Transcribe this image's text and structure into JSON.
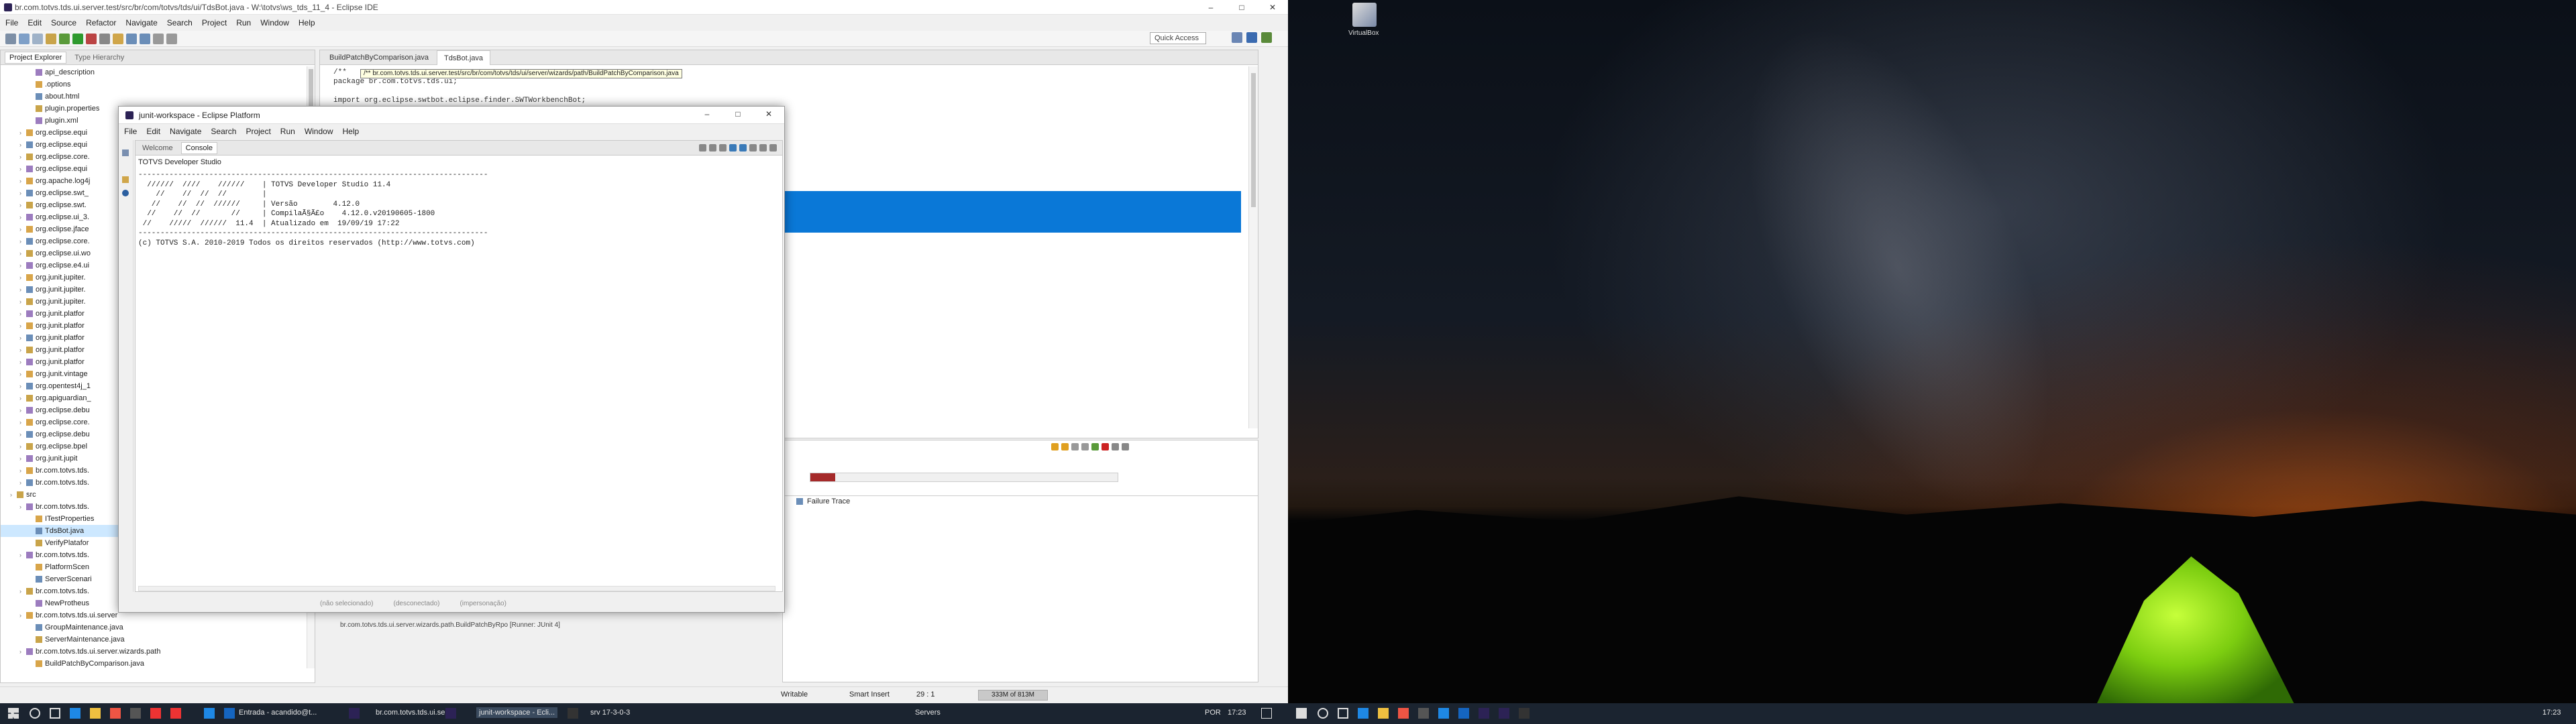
{
  "eclipse": {
    "title": "br.com.totvs.tds.ui.server.test/src/br/com/totvs/tds/ui/TdsBot.java - W:\\totvs\\ws_tds_11_4 - Eclipse IDE",
    "menu": [
      "File",
      "Edit",
      "Source",
      "Refactor",
      "Navigate",
      "Search",
      "Project",
      "Run",
      "Window",
      "Help"
    ],
    "quick_access": "Quick Access"
  },
  "project_explorer": {
    "tabs": [
      "Project Explorer",
      "Type Hierarchy"
    ],
    "items": [
      {
        "label": "api_description",
        "indent": 3
      },
      {
        "label": ".options",
        "indent": 3
      },
      {
        "label": "about.html",
        "indent": 3
      },
      {
        "label": "plugin.properties",
        "indent": 3
      },
      {
        "label": "plugin.xml",
        "indent": 3
      },
      {
        "label": "org.eclipse.equi",
        "indent": 2
      },
      {
        "label": "org.eclipse.equi",
        "indent": 2
      },
      {
        "label": "org.eclipse.core.",
        "indent": 2
      },
      {
        "label": "org.eclipse.equi",
        "indent": 2
      },
      {
        "label": "org.apache.log4j",
        "indent": 2
      },
      {
        "label": "org.eclipse.swt_",
        "indent": 2
      },
      {
        "label": "org.eclipse.swt.",
        "indent": 2
      },
      {
        "label": "org.eclipse.ui_3.",
        "indent": 2
      },
      {
        "label": "org.eclipse.jface",
        "indent": 2
      },
      {
        "label": "org.eclipse.core.",
        "indent": 2
      },
      {
        "label": "org.eclipse.ui.wo",
        "indent": 2
      },
      {
        "label": "org.eclipse.e4.ui",
        "indent": 2
      },
      {
        "label": "org.junit.jupiter.",
        "indent": 2
      },
      {
        "label": "org.junit.jupiter.",
        "indent": 2
      },
      {
        "label": "org.junit.jupiter.",
        "indent": 2
      },
      {
        "label": "org.junit.platfor",
        "indent": 2
      },
      {
        "label": "org.junit.platfor",
        "indent": 2
      },
      {
        "label": "org.junit.platfor",
        "indent": 2
      },
      {
        "label": "org.junit.platfor",
        "indent": 2
      },
      {
        "label": "org.junit.platfor",
        "indent": 2
      },
      {
        "label": "org.junit.vintage",
        "indent": 2
      },
      {
        "label": "org.opentest4j_1",
        "indent": 2
      },
      {
        "label": "org.apiguardian_",
        "indent": 2
      },
      {
        "label": "org.eclipse.debu",
        "indent": 2
      },
      {
        "label": "org.eclipse.core.",
        "indent": 2
      },
      {
        "label": "org.eclipse.debu",
        "indent": 2
      },
      {
        "label": "org.eclipse.bpel",
        "indent": 2
      },
      {
        "label": "org.junit.jupit",
        "indent": 2
      },
      {
        "label": "br.com.totvs.tds.",
        "indent": 2
      },
      {
        "label": "br.com.totvs.tds.",
        "indent": 2
      },
      {
        "label": "src",
        "indent": 1
      },
      {
        "label": "br.com.totvs.tds.",
        "indent": 2
      },
      {
        "label": "ITestProperties",
        "indent": 3
      },
      {
        "label": "TdsBot.java",
        "indent": 3
      },
      {
        "label": "VerifyPlatafor",
        "indent": 3
      },
      {
        "label": "br.com.totvs.tds.",
        "indent": 2
      },
      {
        "label": "PlatformScen",
        "indent": 3
      },
      {
        "label": "ServerScenari",
        "indent": 3
      },
      {
        "label": "br.com.totvs.tds.",
        "indent": 2
      },
      {
        "label": "NewProtheus",
        "indent": 3
      },
      {
        "label": "br.com.totvs.tds.ui.server",
        "indent": 2
      },
      {
        "label": "GroupMaintenance.java",
        "indent": 3
      },
      {
        "label": "ServerMaintenance.java",
        "indent": 3
      },
      {
        "label": "br.com.totvs.tds.ui.server.wizards.path",
        "indent": 2
      },
      {
        "label": "BuildPatchByComparison.java",
        "indent": 3
      }
    ]
  },
  "editor": {
    "tabs": [
      "BuildPatchByComparison.java",
      "TdsBot.java"
    ],
    "hover_path": "/** br.com.totvs.tds.ui.server.test/src/br/com/totvs/tds/ui/server/wizards/path/BuildPatchByComparison.java",
    "code_lines": [
      "/**",
      "package br.com.totvs.tds.ui;",
      "",
      "import org.eclipse.swtbot.eclipse.finder.SWTWorkbenchBot;"
    ]
  },
  "junit": {
    "failure_trace_label": "Failure Trace",
    "runner_entry": "br.com.totvs.tds.ui.server.wizards.path.BuildPatchByRpo [Runner: JUnit 4]",
    "progress": 0.08,
    "progress_color": "#a52a2a"
  },
  "status_bar": {
    "writable": "Writable",
    "insert_mode": "Smart Insert",
    "position": "29 : 1",
    "heap": "333M of 813M"
  },
  "tds_window": {
    "title": "junit-workspace - Eclipse Platform",
    "menu": [
      "File",
      "Edit",
      "Navigate",
      "Search",
      "Project",
      "Run",
      "Window",
      "Help"
    ],
    "tabs": [
      "Welcome",
      "Console"
    ],
    "console_label": "TOTVS Developer Studio",
    "console_lines": [
      "-------------------------------------------------------------------------------",
      "  //////  ////    //////    | TOTVS Developer Studio 11.4",
      "    //    //  //  //        |",
      "   //    //  //  //////     | Versão        4.12.0",
      "  //    //  //       //     | CompilaÃ§Ã£o    4.12.0.v20190605-1800",
      " //    /////  //////  11.4  | Atualizado em  19/09/19 17:22",
      "-------------------------------------------------------------------------------",
      "(c) TOTVS S.A. 2010-2019 Todos os direitos reservados (http://www.totvs.com)"
    ],
    "status_items": [
      "(não selecionado)",
      "(desconectado)",
      "(impersonação)"
    ]
  },
  "desktop": {
    "icon_label": "VirtualBox"
  },
  "taskbar_left": {
    "apps": [
      "Entrada - acandido@t...",
      "br.com.totvs.tds.ui.se...",
      "junit-workspace - Ecli...",
      "srv 17-3-0-3"
    ],
    "tray_label": "Servers",
    "lang": "POR",
    "time": "17:23"
  },
  "taskbar_right": {
    "time": "17:23"
  }
}
